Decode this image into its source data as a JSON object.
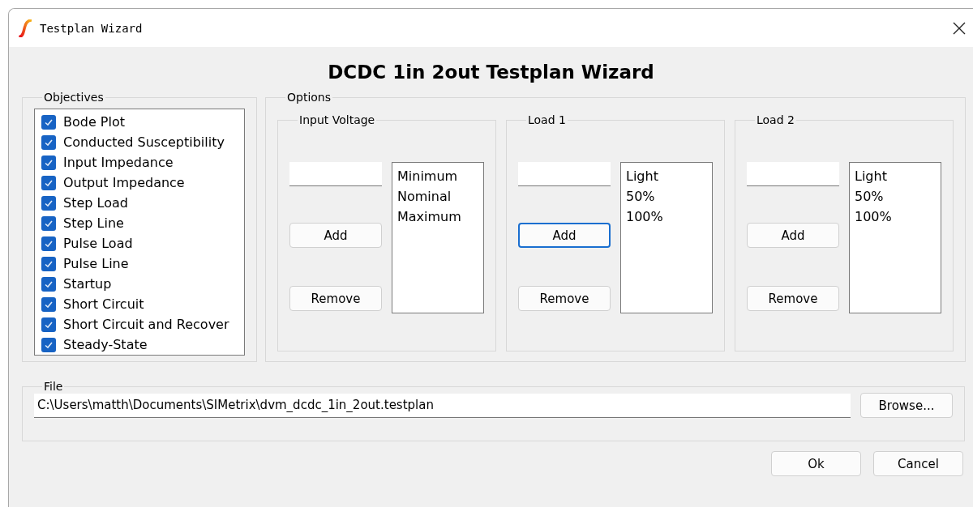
{
  "window": {
    "title": "Testplan Wizard"
  },
  "heading": "DCDC 1in 2out Testplan Wizard",
  "objectives": {
    "label": "Objectives",
    "items": [
      {
        "label": "Bode Plot",
        "checked": true
      },
      {
        "label": "Conducted Susceptibility",
        "checked": true
      },
      {
        "label": "Input Impedance",
        "checked": true
      },
      {
        "label": "Output Impedance",
        "checked": true
      },
      {
        "label": "Step Load",
        "checked": true
      },
      {
        "label": "Step Line",
        "checked": true
      },
      {
        "label": "Pulse Load",
        "checked": true
      },
      {
        "label": "Pulse Line",
        "checked": true
      },
      {
        "label": "Startup",
        "checked": true
      },
      {
        "label": "Short Circuit",
        "checked": true
      },
      {
        "label": "Short Circuit and Recover",
        "checked": true
      },
      {
        "label": "Steady-State",
        "checked": true
      }
    ]
  },
  "options": {
    "label": "Options",
    "groups": [
      {
        "label": "Input Voltage",
        "add": {
          "label": "Add",
          "focused": false
        },
        "remove": "Remove",
        "items": [
          "Minimum",
          "Nominal",
          "Maximum"
        ]
      },
      {
        "label": "Load 1",
        "add": {
          "label": "Add",
          "focused": true
        },
        "remove": "Remove",
        "items": [
          "Light",
          "50%",
          "100%"
        ]
      },
      {
        "label": "Load 2",
        "add": {
          "label": "Add",
          "focused": false
        },
        "remove": "Remove",
        "items": [
          "Light",
          "50%",
          "100%"
        ]
      }
    ]
  },
  "file": {
    "label": "File",
    "value": "C:\\Users\\matth\\Documents\\SIMetrix\\dvm_dcdc_1in_2out.testplan",
    "browse": "Browse..."
  },
  "buttons": [
    "Ok",
    "Cancel"
  ]
}
